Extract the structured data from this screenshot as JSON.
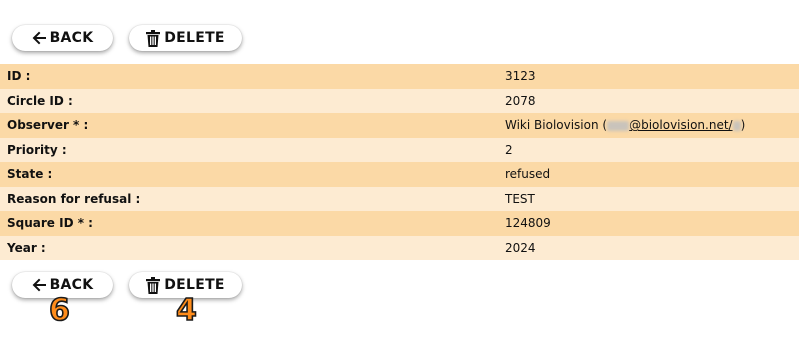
{
  "toolbar": {
    "back_label": "BACK",
    "delete_label": "DELETE"
  },
  "details": {
    "rows": [
      {
        "label": "ID :",
        "value": "3123"
      },
      {
        "label": "Circle ID :",
        "value": "2078"
      },
      {
        "label": "Observer * :",
        "value_prefix": "Wiki Biolovision (",
        "email_domain": "@biolovision.net/",
        "value_suffix": ")"
      },
      {
        "label": "Priority :",
        "value": "2"
      },
      {
        "label": "State :",
        "value": "refused"
      },
      {
        "label": "Reason for refusal :",
        "value": "TEST"
      },
      {
        "label": "Square ID * :",
        "value": "124809"
      },
      {
        "label": "Year :",
        "value": "2024"
      }
    ]
  },
  "annotations": {
    "back_marker": "6",
    "delete_marker": "4",
    "color": "#ff8c1a"
  },
  "colors": {
    "row_odd": "#fbd9a6",
    "row_even": "#fdebd2"
  },
  "icons": {
    "back": "arrow-left-icon",
    "delete": "trash-icon"
  }
}
